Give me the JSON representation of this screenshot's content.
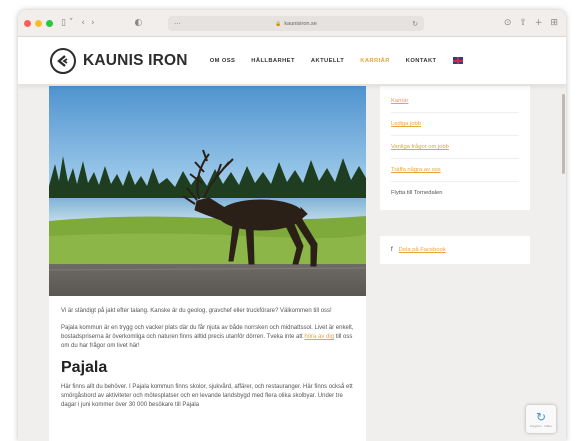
{
  "browser": {
    "url": "kaunisiron.se",
    "lock_icon": "lock-icon",
    "sidebar_icon": "sidebar-toggle-icon",
    "back_icon": "chevron-left-icon",
    "forward_icon": "chevron-right-icon",
    "privacy_icon": "shield-icon",
    "reload_icon": "reload-icon",
    "right_icons": [
      "download-icon",
      "share-icon",
      "new-tab-icon",
      "tab-overview-icon"
    ]
  },
  "site": {
    "brand": "KAUNIS IRON",
    "nav": [
      {
        "label": "OM OSS",
        "active": false
      },
      {
        "label": "HÅLLBARHET",
        "active": false
      },
      {
        "label": "AKTUELLT",
        "active": false
      },
      {
        "label": "KARRIÄR",
        "active": true
      },
      {
        "label": "KONTAKT",
        "active": false
      }
    ],
    "language_flag": "uk-flag-icon",
    "accent_color": "#e8a43a"
  },
  "main": {
    "intro": "Vi är ständigt på jakt efter talang. Kanske är du geolog, gravchef eller truckförare? Välkommen till oss!",
    "para2_start": "Pajala kommun är en trygg och vacker plats där du får njuta av både norrsken och midnattssol. Livet är enkelt, bostadspriserna är överkomliga och naturen finns alltid precis utanför dörren. Tveka inte att ",
    "para2_link": "höra av dig",
    "para2_end": " till oss om du har frågor om livet här!",
    "heading": "Pajala",
    "para3": "Här finns allt du behöver. I Pajala kommun finns skolor, sjukvård, affärer, och restauranger. Här finns också ett smörgåsbord av aktiviteter och mötesplatser och en levande landsbygd med flera olika skolbyar. Under tre dagar i juni kommer över 30 000 besökare till Pajala"
  },
  "sidebar": {
    "links": [
      {
        "label": "Karriär",
        "link": true
      },
      {
        "label": "Lediga jobb",
        "link": true
      },
      {
        "label": "Vanliga frågor om jobb",
        "link": true
      },
      {
        "label": "Träffa några av oss",
        "link": true
      },
      {
        "label": "Flytta till Tornedalen",
        "link": false
      }
    ],
    "facebook_label": "Dela på Facebook"
  },
  "recaptcha": {
    "label": "Integritet - Villkor"
  }
}
